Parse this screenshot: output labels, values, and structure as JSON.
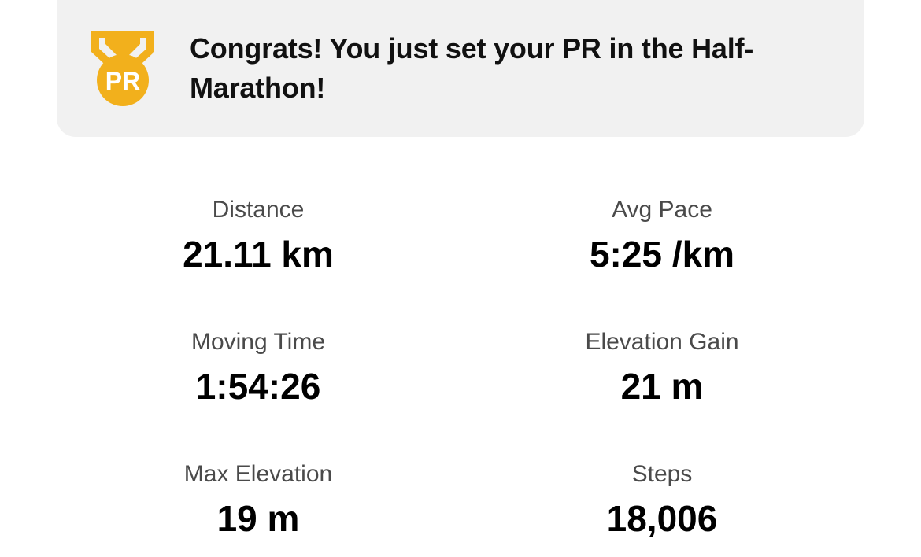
{
  "banner": {
    "badge_text": "PR",
    "badge_icon": "pr-medal-icon",
    "message": "Congrats! You just set your PR in the Half-Marathon!",
    "accent_color": "#F2B01C",
    "background": "#F1F1F1"
  },
  "stats": [
    {
      "label": "Distance",
      "value": "21.11 km"
    },
    {
      "label": "Avg Pace",
      "value": "5:25 /km"
    },
    {
      "label": "Moving Time",
      "value": "1:54:26"
    },
    {
      "label": "Elevation Gain",
      "value": "21 m"
    },
    {
      "label": "Max Elevation",
      "value": "19 m"
    },
    {
      "label": "Steps",
      "value": "18,006"
    }
  ]
}
